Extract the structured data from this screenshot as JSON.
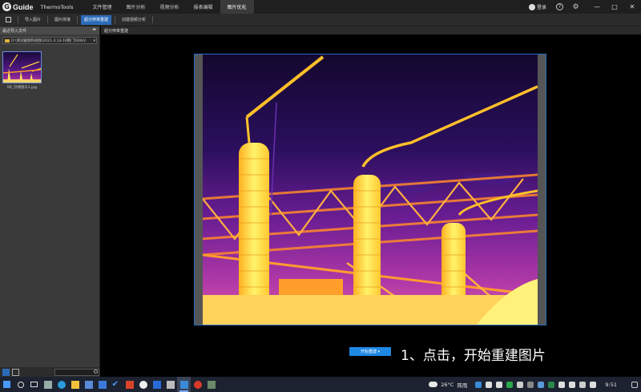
{
  "app": {
    "brand": "Guide",
    "name": "ThermoTools",
    "menu": [
      "文件管理",
      "图片分析",
      "视频分析",
      "报表编辑",
      "图片优化"
    ],
    "active_menu": "图片优化",
    "login": "登录",
    "help_symbol": "?",
    "settings_symbol": "⚙",
    "window_controls": [
      "—",
      "□",
      "✕"
    ]
  },
  "toolbar": {
    "buttons": [
      "导入图片",
      "图片拼接",
      "超分辨率重建",
      "创建视频分析"
    ],
    "active": "超分辨率重建"
  },
  "left_panel": {
    "title": "最近导入文件",
    "path": "D:\\测试截图和视频\\2021.4.14-16荆门500kV",
    "file_name": "00_引线接头1.jpg"
  },
  "main": {
    "tab_title": "超分辨率重建",
    "rebuild_button": "开始重建",
    "caption": "1、点击，开始重建图片"
  },
  "taskbar": {
    "weather_temp": "26°C",
    "weather_text": "阵雨",
    "time": "9:51"
  },
  "colors": {
    "accent": "#2b6cb8",
    "button_blue": "#1e88e5",
    "thermal_hot": "#fff36b",
    "thermal_cold": "#1a0a3d"
  }
}
